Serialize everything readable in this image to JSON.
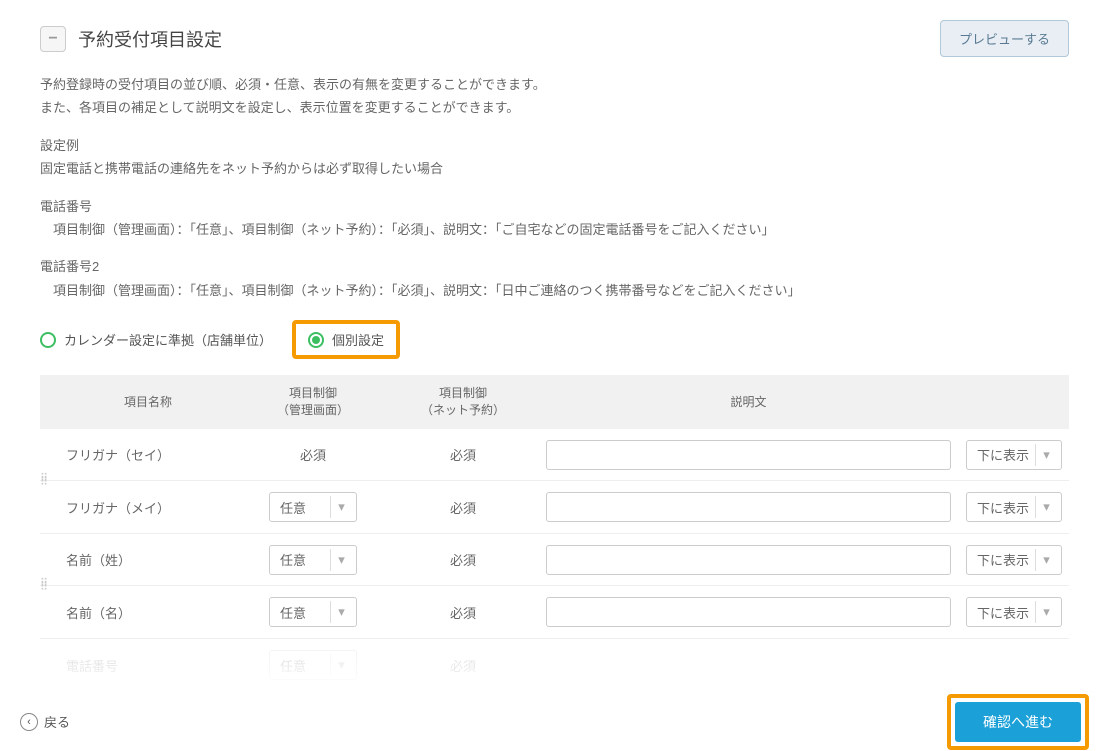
{
  "header": {
    "collapse_glyph": "−",
    "title": "予約受付項目設定",
    "preview_label": "プレビューする"
  },
  "intro": {
    "line1": "予約登録時の受付項目の並び順、必須・任意、表示の有無を変更することができます。",
    "line2": "また、各項目の補足として説明文を設定し、表示位置を変更することができます。"
  },
  "example": {
    "heading": "設定例",
    "line": "固定電話と携帯電話の連絡先をネット予約からは必ず取得したい場合"
  },
  "phone1": {
    "heading": "電話番号",
    "line": "　項目制御（管理画面）：「任意」、項目制御（ネット予約）：「必須」、説明文：「ご自宅などの固定電話番号をご記入ください」"
  },
  "phone2": {
    "heading": "電話番号2",
    "line": "　項目制御（管理画面）：「任意」、項目制御（ネット予約）：「必須」、説明文：「日中ご連絡のつく携帯番号などをご記入ください」"
  },
  "radios": {
    "calendar": "カレンダー設定に準拠（店舗単位）",
    "individual": "個別設定"
  },
  "columns": {
    "name": "項目名称",
    "admin": "項目制御\n（管理画面）",
    "net": "項目制御\n（ネット予約）",
    "desc": "説明文"
  },
  "values": {
    "required": "必須",
    "optional": "任意",
    "pos_below": "下に表示"
  },
  "rows": [
    {
      "name": "フリガナ（セイ）",
      "admin_fixed": true,
      "net": "必須"
    },
    {
      "name": "フリガナ（メイ）",
      "admin_fixed": false,
      "net": "必須"
    },
    {
      "name": "名前（姓）",
      "admin_fixed": false,
      "net": "必須"
    },
    {
      "name": "名前（名）",
      "admin_fixed": false,
      "net": "必須"
    }
  ],
  "faded_row": {
    "name": "電話番号",
    "net": "必須"
  },
  "footer": {
    "back": "戻る",
    "confirm": "確認へ進む"
  }
}
